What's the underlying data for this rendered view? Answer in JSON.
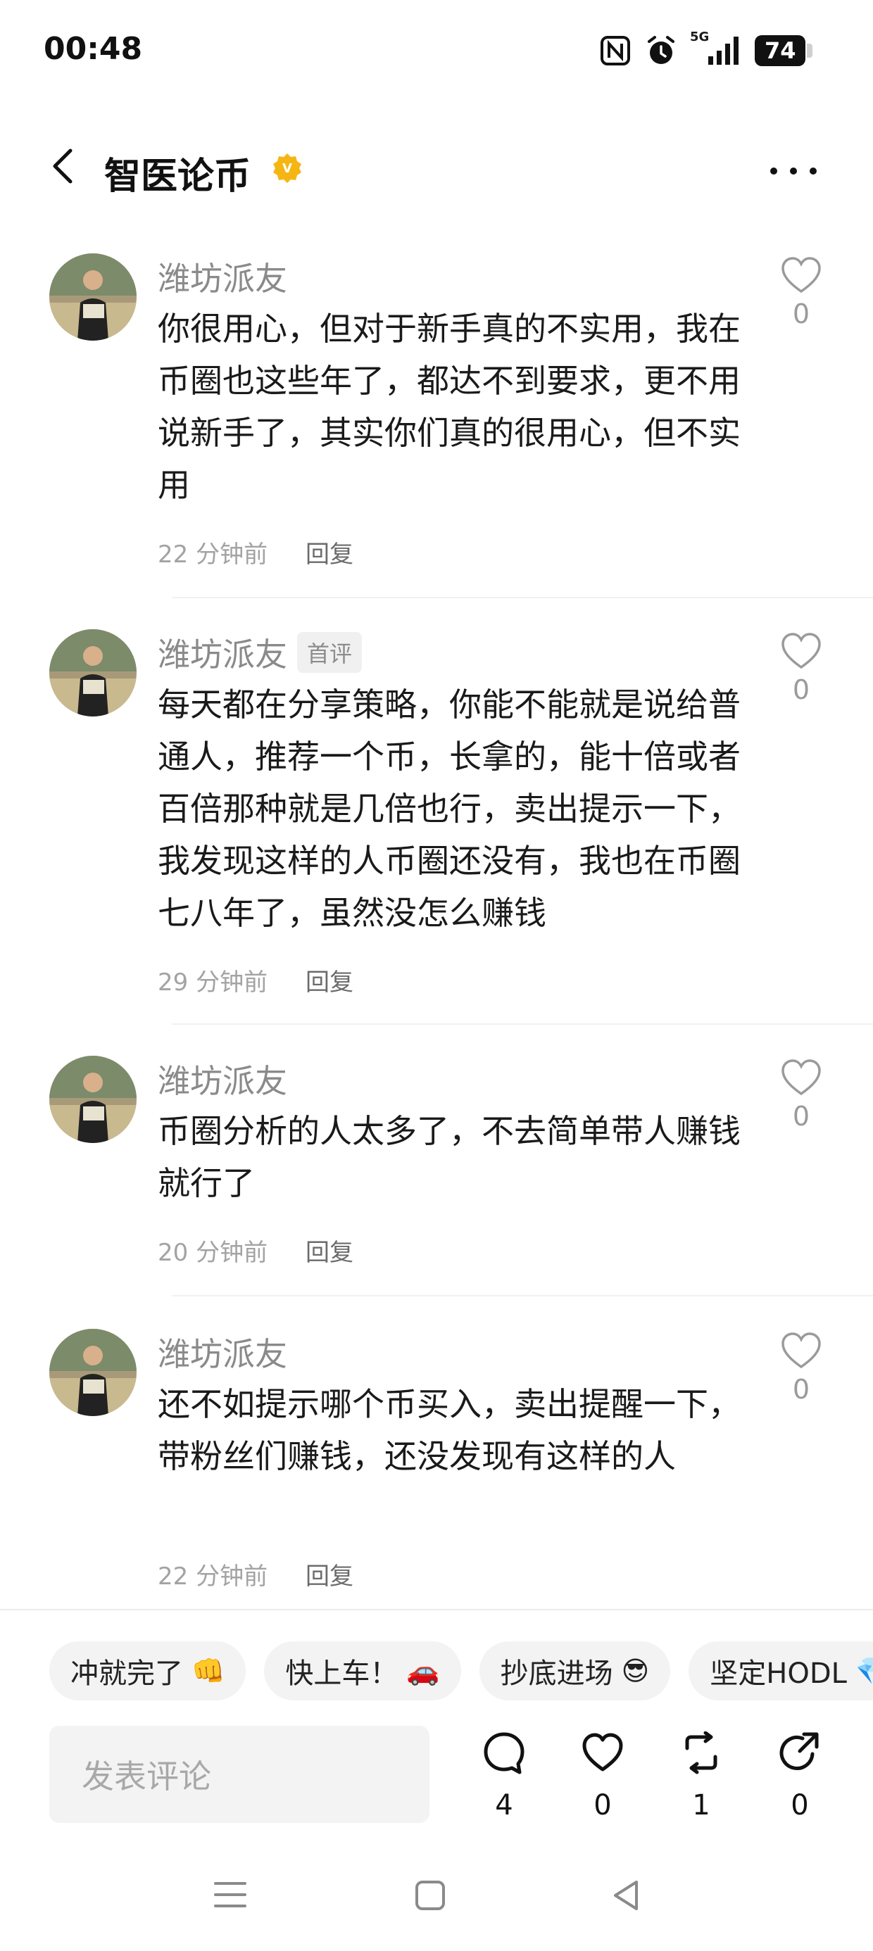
{
  "status_bar": {
    "time": "00:48",
    "battery": "74",
    "network": "5G"
  },
  "header": {
    "title": "智医论币",
    "verified_badge": "V"
  },
  "comments": [
    {
      "user": "潍坊派友",
      "tag": "",
      "text": "你很用心，但对于新手真的不实用，我在币圈也这些年了，都达不到要求，更不用说新手了，其实你们真的很用心，但不实用",
      "time": "22 分钟前",
      "reply": "回复",
      "likes": "0"
    },
    {
      "user": "潍坊派友",
      "tag": "首评",
      "text": "每天都在分享策略，你能不能就是说给普通人，推荐一个币，长拿的，能十倍或者百倍那种就是几倍也行，卖出提示一下，我发现这样的人币圈还没有，我也在币圈七八年了，虽然没怎么赚钱",
      "time": "29 分钟前",
      "reply": "回复",
      "likes": "0"
    },
    {
      "user": "潍坊派友",
      "tag": "",
      "text": "币圈分析的人太多了，不去简单带人赚钱就行了",
      "time": "20 分钟前",
      "reply": "回复",
      "likes": "0"
    },
    {
      "user": "潍坊派友",
      "tag": "",
      "text": "还不如提示哪个币买入，卖出提醒一下，带粉丝们赚钱，还没发现有这样的人",
      "time": "22 分钟前",
      "reply": "回复",
      "likes": "0"
    }
  ],
  "quick_replies": [
    {
      "label": "冲就完了",
      "emoji": "👊"
    },
    {
      "label": "快上车！",
      "emoji": "🚗"
    },
    {
      "label": "抄底进场",
      "emoji": "😎"
    },
    {
      "label": "坚定HODL",
      "emoji": "💎"
    }
  ],
  "comment_input": {
    "placeholder": "发表评论"
  },
  "actions": {
    "comments": "4",
    "likes": "0",
    "reposts": "1",
    "shares": "0"
  },
  "icons": {
    "back": "chevron-left-icon",
    "more": "more-icon",
    "like": "heart-icon",
    "comment": "comment-bubble-icon",
    "repost": "repost-icon",
    "share": "share-icon"
  },
  "colors": {
    "verified": "#F5B614",
    "username": "#8A8A8A",
    "chip_bg": "#F3F3F3"
  }
}
